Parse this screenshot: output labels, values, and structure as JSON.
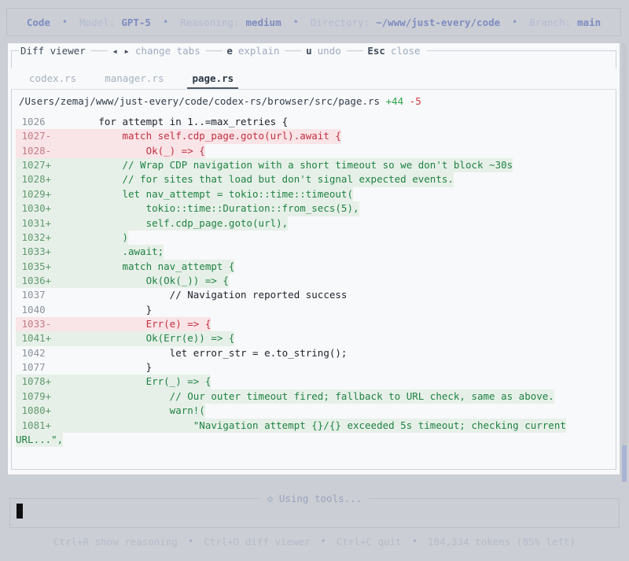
{
  "topbar": {
    "app": "Code",
    "sep": "•",
    "model_label": "Model:",
    "model": "GPT-5",
    "reasoning_label": "Reasoning:",
    "reasoning": "medium",
    "directory_label": "Directory:",
    "directory": "~/www/just-every/code",
    "branch_label": "Branch:",
    "branch": "main"
  },
  "diff_viewer": {
    "header_items": [
      {
        "text": "Diff viewer",
        "kind": "title"
      },
      {
        "text": "───",
        "kind": "dash"
      },
      {
        "text": "◂ ▸",
        "kind": "key"
      },
      {
        "text": "change tabs",
        "kind": "hint"
      },
      {
        "text": "───",
        "kind": "dash"
      },
      {
        "text": "e",
        "kind": "key"
      },
      {
        "text": "explain",
        "kind": "hint"
      },
      {
        "text": "───",
        "kind": "dash"
      },
      {
        "text": "u",
        "kind": "key"
      },
      {
        "text": "undo",
        "kind": "hint"
      },
      {
        "text": "───",
        "kind": "dash"
      },
      {
        "text": "Esc",
        "kind": "key"
      },
      {
        "text": "close",
        "kind": "hint"
      }
    ],
    "tabs": [
      {
        "label": "codex.rs",
        "active": false
      },
      {
        "label": "manager.rs",
        "active": false
      },
      {
        "label": "page.rs",
        "active": true
      }
    ],
    "file_path": "/Users/zemaj/www/just-every/code/codex-rs/browser/src/page.rs",
    "additions": "+44",
    "deletions": "-5",
    "lines": [
      {
        "num": "1026",
        "type": "context",
        "code": "        for attempt in 1..=max_retries {"
      },
      {
        "num": "1027",
        "type": "remove",
        "code": "            match self.cdp_page.goto(url).await {"
      },
      {
        "num": "1028",
        "type": "remove",
        "code": "                Ok(_) => {"
      },
      {
        "num": "1027",
        "type": "add",
        "code": "            // Wrap CDP navigation with a short timeout so we don't block ~30s"
      },
      {
        "num": "1028",
        "type": "add",
        "code": "            // for sites that load but don't signal expected events."
      },
      {
        "num": "1029",
        "type": "add",
        "code": "            let nav_attempt = tokio::time::timeout("
      },
      {
        "num": "1030",
        "type": "add",
        "code": "                tokio::time::Duration::from_secs(5),"
      },
      {
        "num": "1031",
        "type": "add",
        "code": "                self.cdp_page.goto(url),"
      },
      {
        "num": "1032",
        "type": "add",
        "code": "            )"
      },
      {
        "num": "1033",
        "type": "add",
        "code": "            .await;"
      },
      {
        "num": "1035",
        "type": "add",
        "code": "            match nav_attempt {"
      },
      {
        "num": "1036",
        "type": "add",
        "code": "                Ok(Ok(_)) => {"
      },
      {
        "num": "1037",
        "type": "context",
        "code": "                    // Navigation reported success"
      },
      {
        "num": "1040",
        "type": "context",
        "code": "                }"
      },
      {
        "num": "1033",
        "type": "remove",
        "code": "                Err(e) => {"
      },
      {
        "num": "1041",
        "type": "add",
        "code": "                Ok(Err(e)) => {"
      },
      {
        "num": "1042",
        "type": "context",
        "code": "                    let error_str = e.to_string();"
      },
      {
        "num": "1077",
        "type": "context",
        "code": "                }"
      },
      {
        "num": "1078",
        "type": "add",
        "code": "                Err(_) => {"
      },
      {
        "num": "1079",
        "type": "add",
        "code": "                    // Our outer timeout fired; fallback to URL check, same as above."
      },
      {
        "num": "1080",
        "type": "add",
        "code": "                    warn!("
      },
      {
        "num": "1081",
        "type": "add",
        "code": "                        \"Navigation attempt {}/{} exceeded 5s timeout; checking current"
      },
      {
        "num": "",
        "type": "add-wrap",
        "code": "URL...\","
      }
    ]
  },
  "composer": {
    "status_title": "◇ Using tools..."
  },
  "footer": {
    "sep": "•",
    "items": [
      "Ctrl+R show reasoning",
      "Ctrl+D diff viewer",
      "Ctrl+C quit",
      "104,334 tokens (85% left)"
    ]
  },
  "colors": {
    "background": "#cbced4",
    "panel_background": "#f8f9fa",
    "accent_blue": "#7e8cc0",
    "added_text": "#1f8244",
    "added_background": "#e7f0e8",
    "removed_text": "#c33041",
    "removed_background": "#f9e4e7",
    "additions_badge": "#2da44e",
    "deletions_badge": "#d1353f"
  }
}
